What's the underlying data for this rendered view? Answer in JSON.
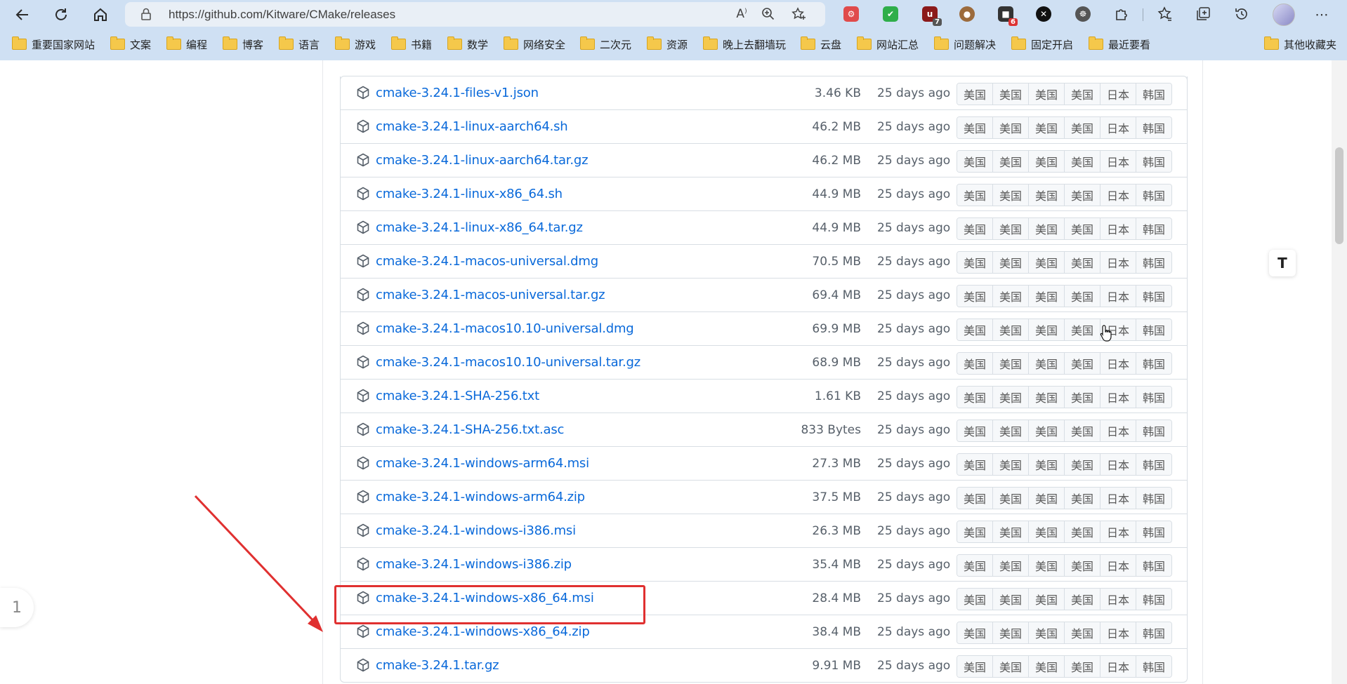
{
  "browser": {
    "url": "https://github.com/Kitware/CMake/releases",
    "extensions": [
      {
        "icon": "red-settings-ext-icon",
        "color": "#e04b4b"
      },
      {
        "icon": "green-shield-ext-icon",
        "color": "#2fae4a"
      },
      {
        "icon": "ublock-ext-icon",
        "color": "#8b1a1a",
        "badge": "7"
      },
      {
        "icon": "cookie-ext-icon",
        "color": "#9c6b3c"
      },
      {
        "icon": "ext-badge-icon",
        "color": "#333333",
        "badge": "6"
      },
      {
        "icon": "x-ext-icon",
        "color": "#111111"
      },
      {
        "icon": "gear-ext-icon",
        "color": "#555555"
      }
    ],
    "bookmarks": [
      "重要国家网站",
      "文案",
      "编程",
      "博客",
      "语言",
      "游戏",
      "书籍",
      "数学",
      "网络安全",
      "二次元",
      "资源",
      "晚上去翻墙玩",
      "云盘",
      "网站汇总",
      "问题解决",
      "固定开启",
      "最近要看",
      "其他收藏夹"
    ]
  },
  "assets": {
    "mirror_labels": [
      "美国",
      "美国",
      "美国",
      "美国",
      "日本",
      "韩国"
    ],
    "rows": [
      {
        "name": "cmake-3.24.1-files-v1.json",
        "size": "3.46 KB",
        "date": "25 days ago"
      },
      {
        "name": "cmake-3.24.1-linux-aarch64.sh",
        "size": "46.2 MB",
        "date": "25 days ago"
      },
      {
        "name": "cmake-3.24.1-linux-aarch64.tar.gz",
        "size": "46.2 MB",
        "date": "25 days ago"
      },
      {
        "name": "cmake-3.24.1-linux-x86_64.sh",
        "size": "44.9 MB",
        "date": "25 days ago"
      },
      {
        "name": "cmake-3.24.1-linux-x86_64.tar.gz",
        "size": "44.9 MB",
        "date": "25 days ago"
      },
      {
        "name": "cmake-3.24.1-macos-universal.dmg",
        "size": "70.5 MB",
        "date": "25 days ago"
      },
      {
        "name": "cmake-3.24.1-macos-universal.tar.gz",
        "size": "69.4 MB",
        "date": "25 days ago"
      },
      {
        "name": "cmake-3.24.1-macos10.10-universal.dmg",
        "size": "69.9 MB",
        "date": "25 days ago"
      },
      {
        "name": "cmake-3.24.1-macos10.10-universal.tar.gz",
        "size": "68.9 MB",
        "date": "25 days ago"
      },
      {
        "name": "cmake-3.24.1-SHA-256.txt",
        "size": "1.61 KB",
        "date": "25 days ago"
      },
      {
        "name": "cmake-3.24.1-SHA-256.txt.asc",
        "size": "833 Bytes",
        "date": "25 days ago"
      },
      {
        "name": "cmake-3.24.1-windows-arm64.msi",
        "size": "27.3 MB",
        "date": "25 days ago"
      },
      {
        "name": "cmake-3.24.1-windows-arm64.zip",
        "size": "37.5 MB",
        "date": "25 days ago"
      },
      {
        "name": "cmake-3.24.1-windows-i386.msi",
        "size": "26.3 MB",
        "date": "25 days ago"
      },
      {
        "name": "cmake-3.24.1-windows-i386.zip",
        "size": "35.4 MB",
        "date": "25 days ago"
      },
      {
        "name": "cmake-3.24.1-windows-x86_64.msi",
        "size": "28.4 MB",
        "date": "25 days ago",
        "highlighted": true
      },
      {
        "name": "cmake-3.24.1-windows-x86_64.zip",
        "size": "38.4 MB",
        "date": "25 days ago"
      },
      {
        "name": "cmake-3.24.1.tar.gz",
        "size": "9.91 MB",
        "date": "25 days ago"
      }
    ]
  },
  "side_tab": {
    "label": "1"
  },
  "translate_button": {
    "label": "T"
  },
  "colors": {
    "link": "#0969da",
    "annotation": "#e03030",
    "chrome": "#cfe0f3"
  }
}
